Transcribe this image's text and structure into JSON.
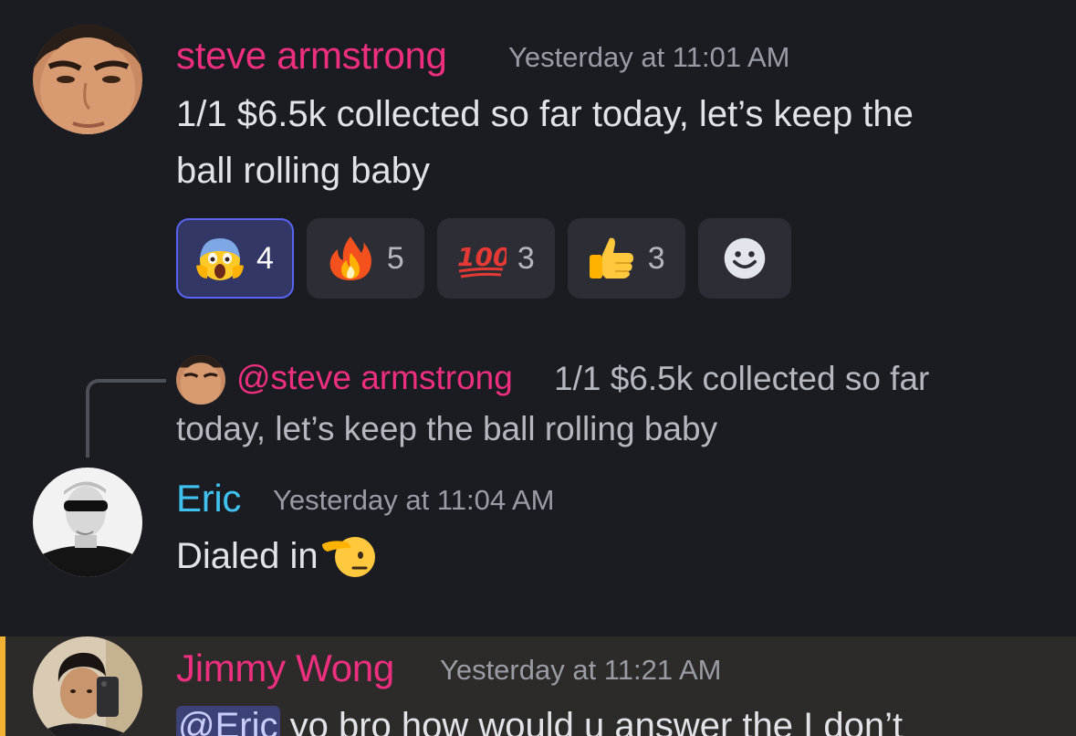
{
  "messages": [
    {
      "author": "steve armstrong",
      "author_color": "#ee2f7f",
      "timestamp": "Yesterday at 11:01 AM",
      "line1": "1/1  $6.5k collected so far today, let’s keep the",
      "line2": "ball rolling baby",
      "reactions": [
        {
          "emoji": "face-screaming-in-fear",
          "count": "4",
          "selected": true
        },
        {
          "emoji": "fire",
          "count": "5",
          "selected": false
        },
        {
          "emoji": "hundred-points",
          "count": "3",
          "selected": false
        },
        {
          "emoji": "thumbs-up",
          "count": "3",
          "selected": false
        },
        {
          "emoji": "add-reaction-smiley",
          "count": "",
          "selected": false
        }
      ]
    },
    {
      "reply_to": {
        "author": "@steve armstrong",
        "preview_line1": "1/1  $6.5k collected so far",
        "preview_line2": "today, let’s keep the ball rolling baby"
      },
      "author": "Eric",
      "author_color": "#3fc2f0",
      "timestamp": "Yesterday at 11:04 AM",
      "text": "Dialed in",
      "emoji": "saluting-face"
    },
    {
      "author": "Jimmy Wong",
      "author_color": "#ee2f7f",
      "timestamp": "Yesterday at 11:21 AM",
      "mention": "@Eric",
      "text": " yo bro how would u answer the I don’t",
      "highlighted": true,
      "highlight_color": "#f0b232"
    }
  ]
}
